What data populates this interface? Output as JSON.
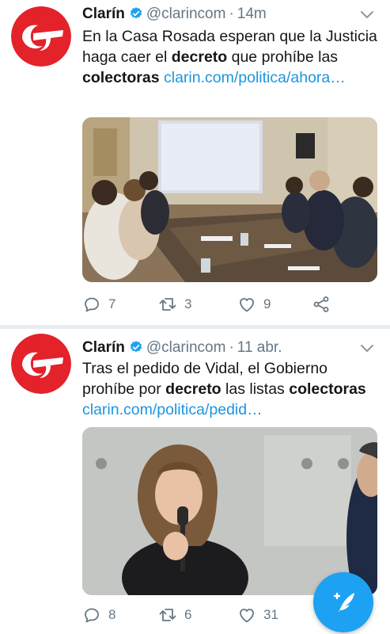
{
  "colors": {
    "brand_red": "#e3222a",
    "link_blue": "#1b95e0",
    "verified_blue": "#1da1f2",
    "meta_gray": "#657786",
    "fab_blue": "#1da1f2"
  },
  "tweets": [
    {
      "author_name": "Clarín",
      "handle": "@clarincom",
      "separator": "·",
      "time": "14m",
      "text_segments": [
        "En la Casa Rosada esperan que la Justicia haga caer el ",
        "decreto",
        " que prohíbe las ",
        "colectoras",
        " "
      ],
      "link": "clarin.com/politica/ahora…",
      "replies": "7",
      "retweets": "3",
      "likes": "9",
      "media_icon": "meeting-photo"
    },
    {
      "author_name": "Clarín",
      "handle": "@clarincom",
      "separator": "·",
      "time": "11 abr.",
      "text_segments": [
        "Tras el pedido de Vidal, el Gobierno prohíbe por ",
        "decreto",
        " las listas ",
        "colectoras",
        " "
      ],
      "link": "clarin.com/politica/pedid…",
      "replies": "8",
      "retweets": "6",
      "likes": "31",
      "media_icon": "speaker-photo"
    }
  ],
  "icons": {
    "avatar": "clarin-logo-icon",
    "verified": "verified-badge-icon",
    "caret": "chevron-down-icon",
    "reply": "reply-icon",
    "retweet": "retweet-icon",
    "like": "heart-icon",
    "share": "share-icon",
    "compose": "compose-tweet-icon"
  }
}
